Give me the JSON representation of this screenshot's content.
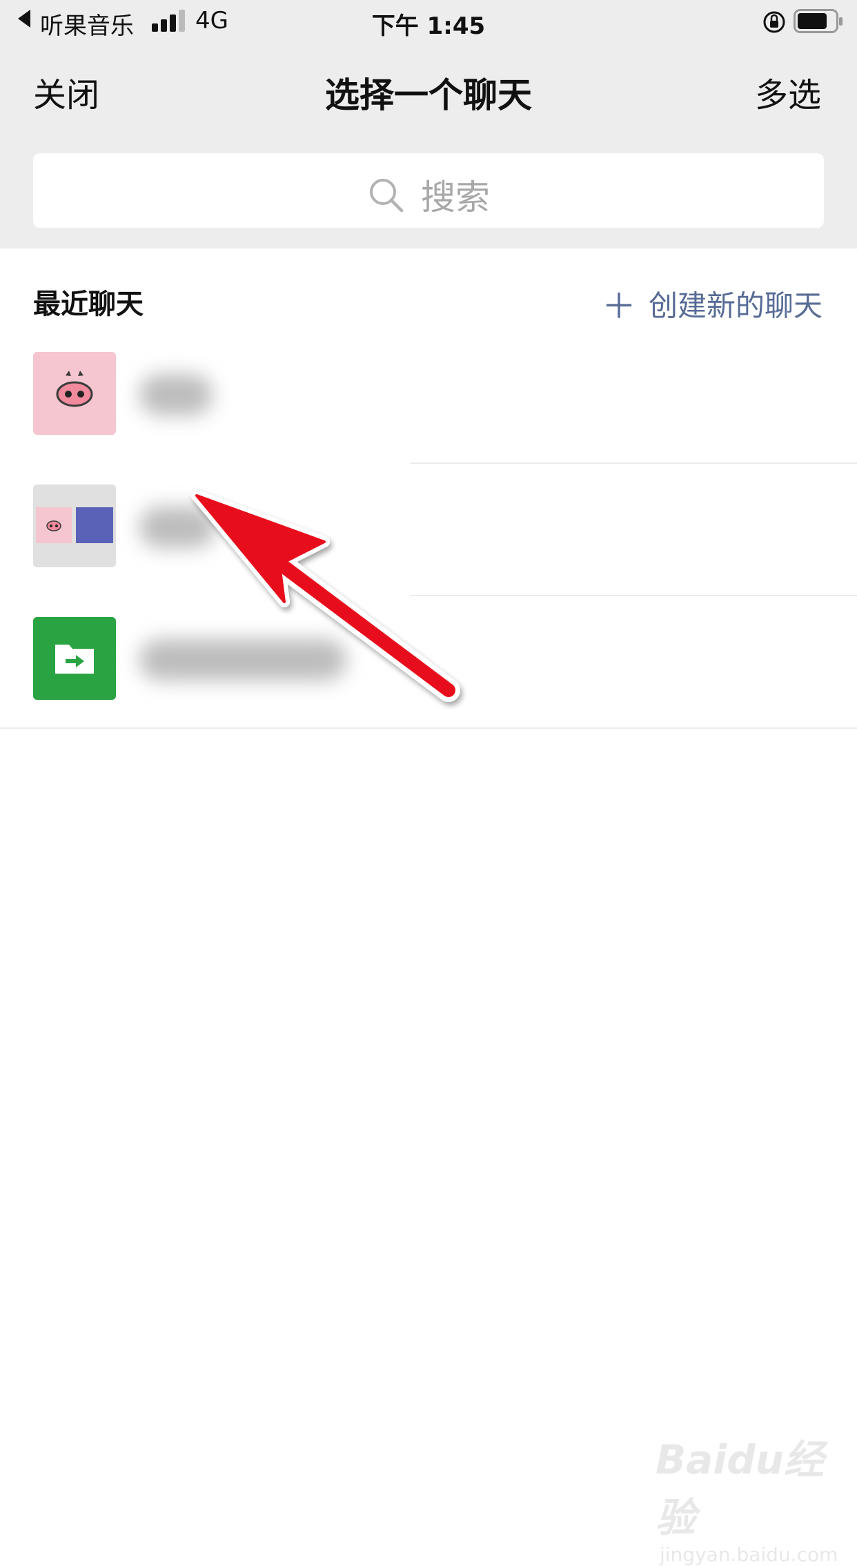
{
  "status_bar": {
    "carrier": "听果音乐",
    "network": "4G",
    "time": "下午 1:45"
  },
  "nav": {
    "close_label": "关闭",
    "title": "选择一个聊天",
    "multi_select_label": "多选"
  },
  "search": {
    "placeholder": "搜索"
  },
  "recent": {
    "header": "最近聊天",
    "create_new_label": "创建新的聊天",
    "create_new_icon": "plus-icon",
    "items": [
      {
        "avatar": "pig-icon",
        "avatar_bg": "#f5c6d0",
        "name_hidden": true
      },
      {
        "avatar": "group-avatar",
        "avatar_bg": "#e0e0e0",
        "name_hidden": true
      },
      {
        "avatar": "file-transfer-icon",
        "avatar_bg": "#2aa343",
        "name_hidden": true
      }
    ]
  },
  "watermark": {
    "main": "Baidu经验",
    "sub": "jingyan.baidu.com"
  },
  "colors": {
    "top_bg": "#ededed",
    "link_blue": "#576b95",
    "arrow_red": "#e8101a"
  }
}
